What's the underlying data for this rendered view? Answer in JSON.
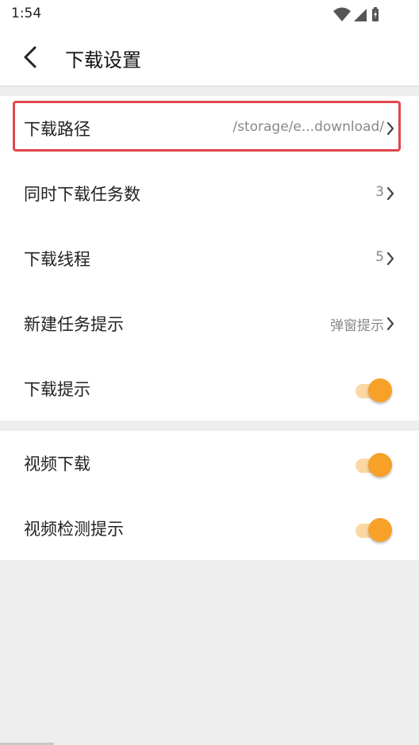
{
  "status_bar": {
    "time": "1:54",
    "icons": [
      "wifi-icon",
      "signal-icon",
      "battery-icon"
    ]
  },
  "app_bar": {
    "back_icon": "back-arrow-icon",
    "title": "下载设置"
  },
  "settings": {
    "download_path": {
      "label": "下载路径",
      "value": "/storage/e...download/"
    },
    "concurrent_tasks": {
      "label": "同时下载任务数",
      "value": "3"
    },
    "threads": {
      "label": "下载线程",
      "value": "5"
    },
    "new_task_prompt": {
      "label": "新建任务提示",
      "value": "弹窗提示"
    },
    "download_prompt": {
      "label": "下载提示",
      "on": true
    },
    "video_download": {
      "label": "视频下载",
      "on": true
    },
    "video_detect_prompt": {
      "label": "视频检测提示",
      "on": true
    }
  },
  "colors": {
    "accent": "#f7a128",
    "accent_track": "#fbd7a3",
    "highlight": "#e0474c"
  }
}
